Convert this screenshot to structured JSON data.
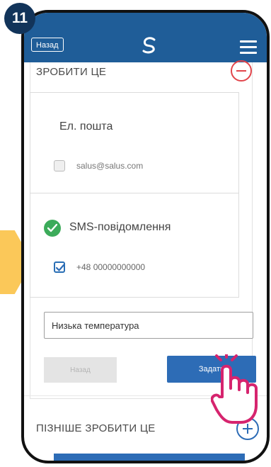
{
  "step_number": "11",
  "header": {
    "back_label": "Назад"
  },
  "rule": {
    "section_title": "ЗРОБИТИ ЦЕ",
    "email": {
      "title": "Ел. пошта",
      "address": "salus@salus.com",
      "checked": false
    },
    "sms": {
      "title": "SMS-повідомлення",
      "phone": "+48 00000000000",
      "checked": true
    },
    "message_input_value": "Низька температура",
    "back_button_label": "Назад",
    "set_button_label": "Задати"
  },
  "later_section": {
    "title": "ПІЗНІШЕ ЗРОБИТИ ЦЕ"
  },
  "colors": {
    "header_blue": "#1f5d98",
    "accent_blue": "#2d6cb6",
    "success_green": "#3cab5a",
    "remove_red": "#e2454b",
    "highlight_yellow": "#fbc859",
    "badge_navy": "#12345a",
    "hand_pink": "#d6246e"
  },
  "icons": [
    "step-badge",
    "logo-icon",
    "menu-icon",
    "minus-circle-icon",
    "check-circle-icon",
    "checkbox-checked-icon",
    "plus-circle-icon",
    "pointing-hand-icon",
    "arrow-indicator"
  ]
}
